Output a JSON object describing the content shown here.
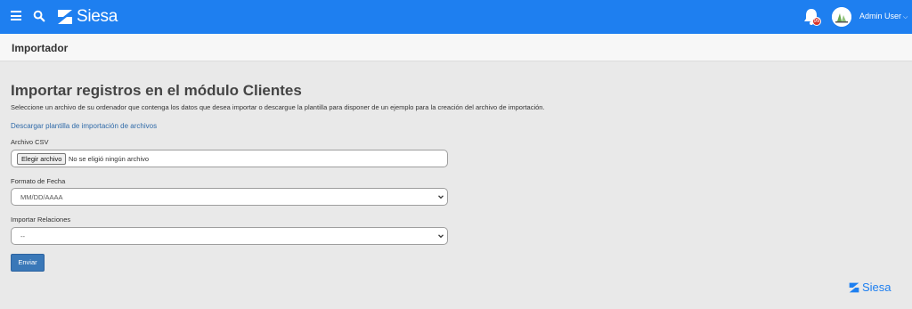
{
  "brand": {
    "name": "Siesa",
    "color": "#1e7ff0"
  },
  "header": {
    "user_label": "Admin User",
    "notification_badge": "99",
    "icons": [
      "menu-icon",
      "search-icon",
      "bell-icon",
      "chevron-down-icon"
    ]
  },
  "page": {
    "title": "Importador"
  },
  "content": {
    "heading": "Importar registros en el módulo Clientes",
    "description": "Seleccione un archivo de su ordenador que contenga los datos que desea importar o descargue la plantilla para disponer de un ejemplo para la creación del archivo de importación.",
    "download_link": "Descargar plantilla de importación de archivos"
  },
  "form": {
    "csv": {
      "label": "Archivo CSV",
      "button": "Elegir archivo",
      "status": "No se eligió ningún archivo"
    },
    "date_format": {
      "label": "Formato de Fecha",
      "value": "MM/DD/AAAA"
    },
    "relations": {
      "label": "Importar Relaciones",
      "value": "--"
    },
    "submit": "Enviar"
  },
  "footer": {
    "brand": "Siesa"
  },
  "colors": {
    "accent": "#1e7ff0",
    "button": "#3a78b8",
    "link": "#2f6aa8",
    "badge": "#d9342b"
  }
}
